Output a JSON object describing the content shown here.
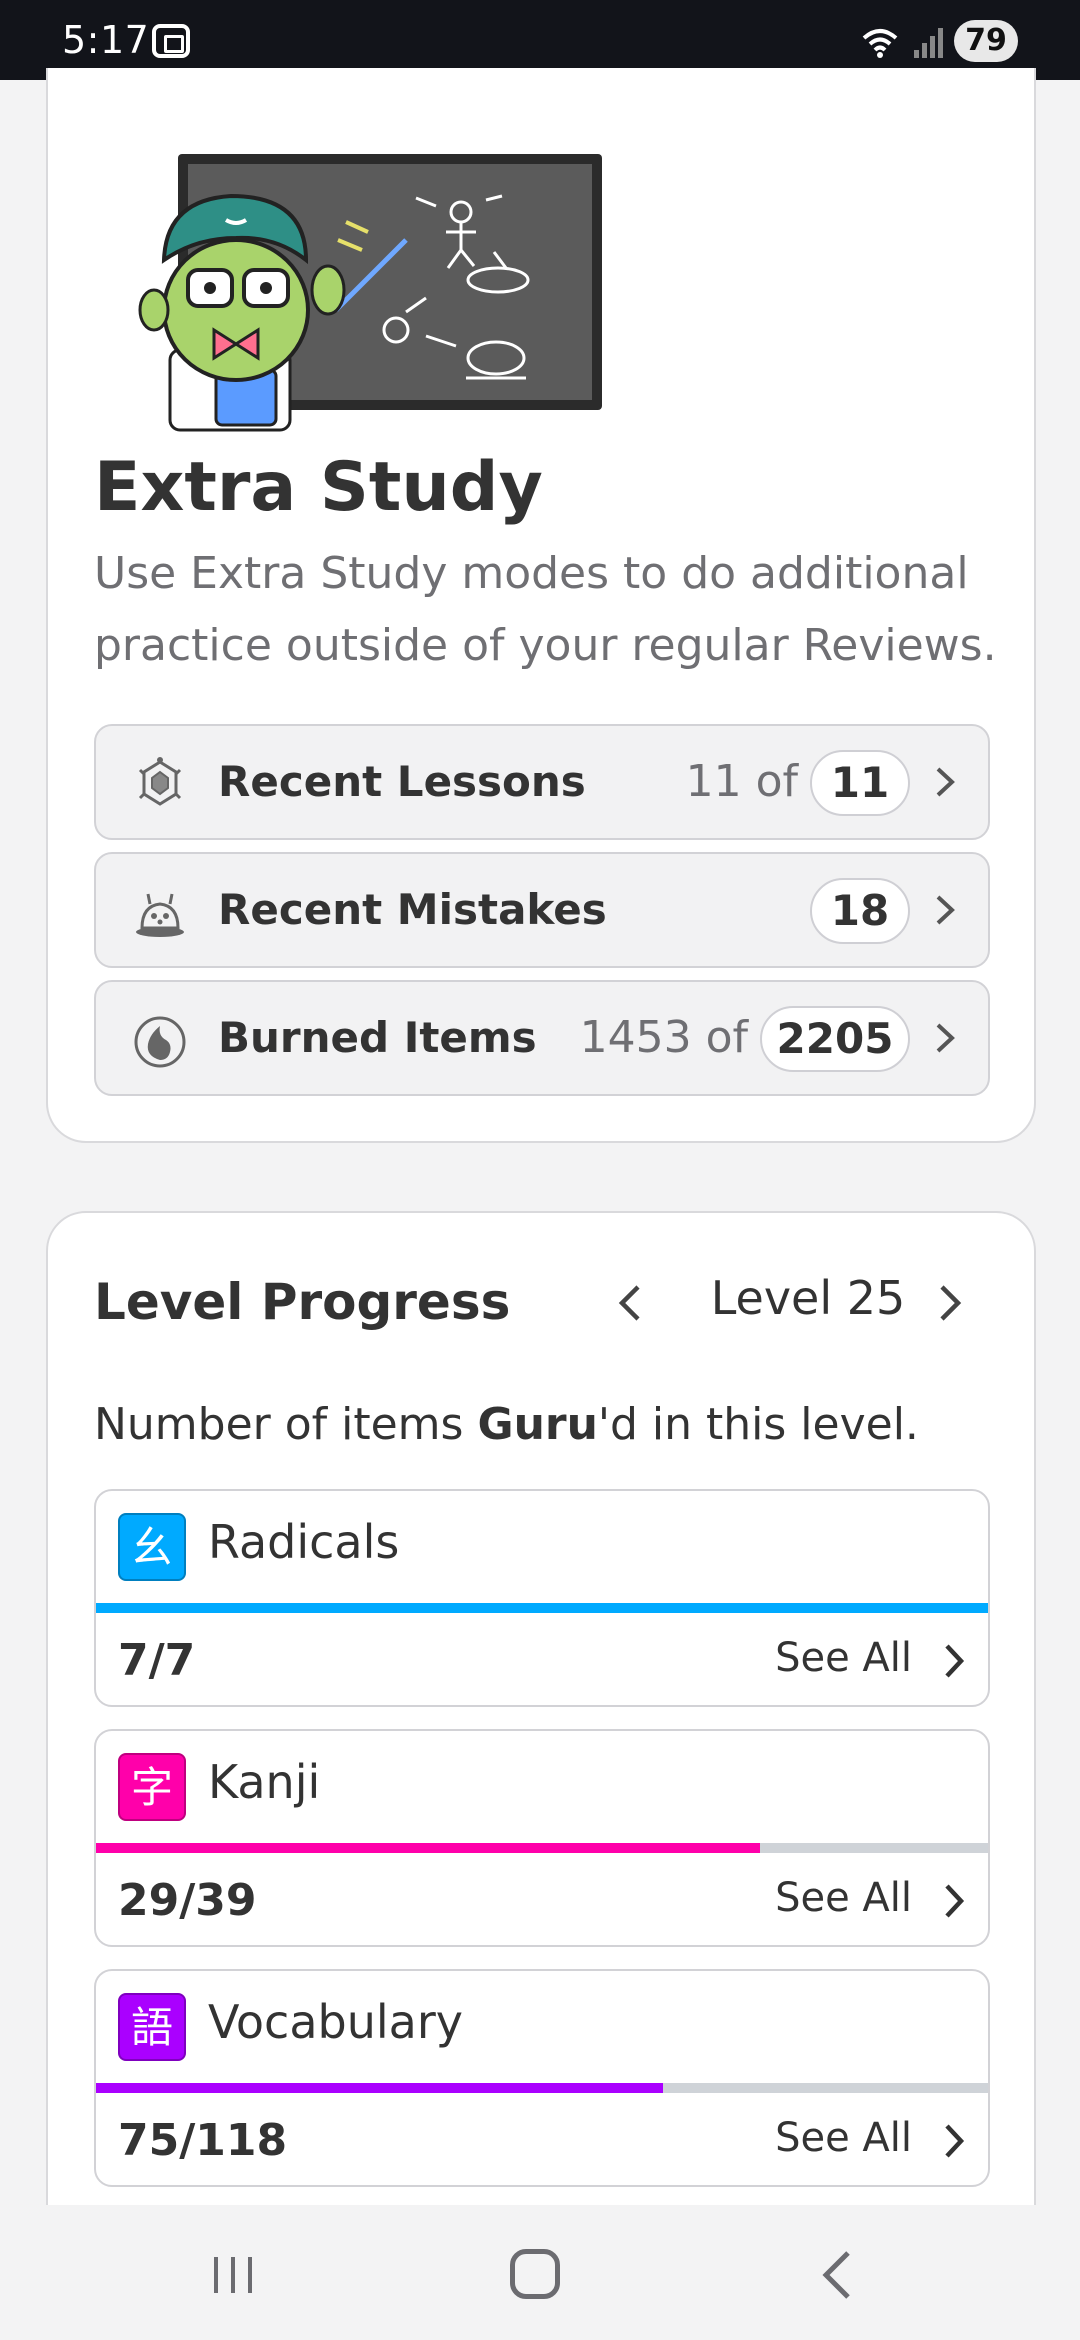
{
  "status_bar": {
    "time": "5:17",
    "battery": "79"
  },
  "extra_study": {
    "title": "Extra Study",
    "description": "Use Extra Study modes to do additional practice outside of your regular Reviews.",
    "items": [
      {
        "label": "Recent Lessons",
        "of": "11 of",
        "count": "11",
        "icon": "turtle-icon"
      },
      {
        "label": "Recent Mistakes",
        "of": "",
        "count": "18",
        "icon": "crab-icon"
      },
      {
        "label": "Burned Items",
        "of": "1453 of",
        "count": "2205",
        "icon": "flame-icon"
      }
    ]
  },
  "level_progress": {
    "title": "Level Progress",
    "level_label": "Level 25",
    "desc_prefix": "Number of items ",
    "desc_bold": "Guru",
    "desc_suffix": "'d in this level.",
    "see_all": "See All",
    "categories": [
      {
        "name": "Radicals",
        "glyph": "幺",
        "count": "7/7",
        "progress": 1.0,
        "color": "#00aaff"
      },
      {
        "name": "Kanji",
        "glyph": "字",
        "count": "29/39",
        "progress": 0.744,
        "color": "#ff00aa"
      },
      {
        "name": "Vocabulary",
        "glyph": "語",
        "count": "75/118",
        "progress": 0.636,
        "color": "#aa00ff"
      }
    ]
  }
}
